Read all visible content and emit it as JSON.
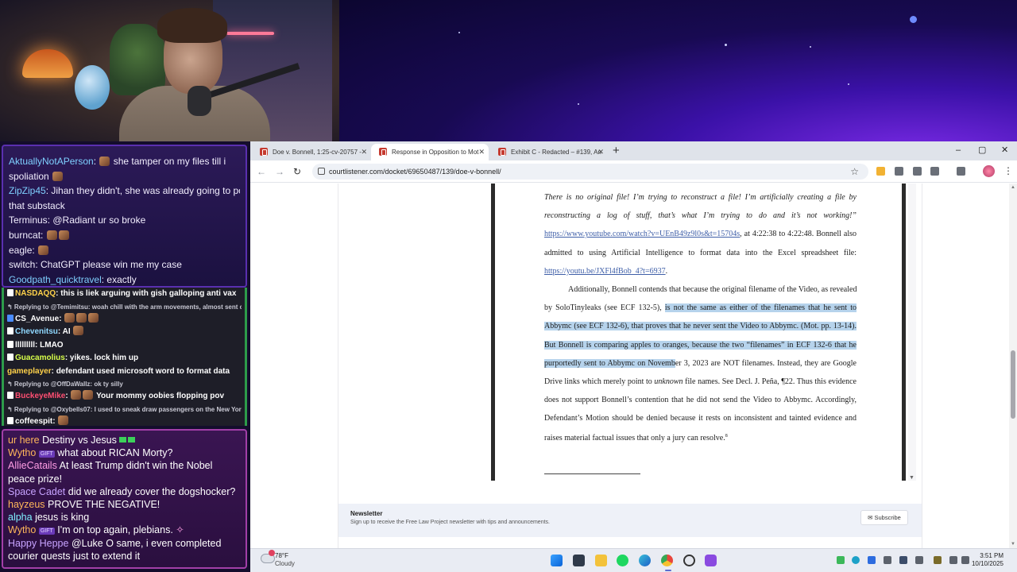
{
  "chat_top": [
    {
      "user": "AktuallyNotAPerson",
      "text": "she tamper on my files till i",
      "style": "blue"
    },
    {
      "user": "",
      "text": "spoliation",
      "style": "plain"
    },
    {
      "user": "ZipZip45",
      "text": "Jihan they didn't, she was already going to post",
      "style": "blue"
    },
    {
      "user": "",
      "text": "that substack",
      "style": "plain"
    },
    {
      "user": "Terminus",
      "text": "@Radiant ur so broke",
      "style": "plain"
    },
    {
      "user": "burncat",
      "text": "",
      "style": "plain"
    },
    {
      "user": "eagle",
      "text": "",
      "style": "plain"
    },
    {
      "user": "switch",
      "text": "ChatGPT please win me my case",
      "style": "plain"
    },
    {
      "user": "Goodpath_quicktravel",
      "text": "exactly",
      "style": "blue"
    }
  ],
  "chat_mid": [
    {
      "name": "NASDAQQ",
      "text": "this is liek arguing with gish galloping anti vax",
      "type": "msg",
      "color": "gold"
    },
    {
      "name": "",
      "text": "↰ Replying to @Temimitsu: woah chill with the arm movements, almost sent c",
      "type": "reply",
      "color": ""
    },
    {
      "name": "CS_Avenue",
      "text": "",
      "type": "msg",
      "color": "white"
    },
    {
      "name": "Chevenitsu",
      "text": "AI",
      "type": "msg",
      "color": "blue"
    },
    {
      "name": "lllllllll",
      "text": "LMAO",
      "type": "msg",
      "color": "white"
    },
    {
      "name": "Guacamolius",
      "text": "yikes. lock him up",
      "type": "msg",
      "color": "lime"
    },
    {
      "name": "gameplayer",
      "text": "defendant used microsoft word to format data",
      "type": "msg",
      "color": "gold"
    },
    {
      "name": "",
      "text": "↰ Replying to @OffDaWallz: ok ty silly",
      "type": "reply",
      "color": ""
    },
    {
      "name": "BuckeyeMike",
      "text": "Your mommy oobies flopping pov",
      "type": "msg",
      "color": "pink"
    },
    {
      "name": "",
      "text": "↰ Replying to @Oxybells07: I used to sneak draw passengers on the New York",
      "type": "reply",
      "color": ""
    },
    {
      "name": "coffeespit",
      "text": "",
      "type": "msg",
      "color": "white"
    }
  ],
  "chat_bottom": [
    {
      "user": "ur here",
      "text": "Destiny vs Jesus",
      "color": "orange",
      "tag": false
    },
    {
      "user": "Wytho",
      "text": "what about RICAN Morty?",
      "color": "orange",
      "tag": true
    },
    {
      "user": "AllieCatails",
      "text": "At least Trump didn't win the Nobel peace prize!",
      "color": "pink",
      "tag": false
    },
    {
      "user": "Space Cadet",
      "text": "did we already cover the dogshocker?",
      "color": "violet",
      "tag": false
    },
    {
      "user": "hayzeus",
      "text": "PROVE THE NEGATIVE!",
      "color": "orange",
      "tag": false
    },
    {
      "user": "alpha",
      "text": "jesus is king",
      "color": "cyan",
      "tag": false
    },
    {
      "user": "Wytho",
      "text": "I'm on top again, plebians.",
      "color": "orange",
      "tag": true
    },
    {
      "user": "Happy Heppe",
      "text": "@Luke O same, i even completed courier quests just to extend it",
      "color": "violet",
      "tag": false
    }
  ],
  "chat_tag": "GIFT",
  "browser": {
    "tabs": [
      {
        "title": "Doe v. Bonnell, 1:25-cv-20757 -",
        "active": false
      },
      {
        "title": "Response in Opposition to Mot",
        "active": true
      },
      {
        "title": "Exhibit C - Redacted – #139, An",
        "active": false
      }
    ],
    "new_tab": "+",
    "url": "courtlistener.com/docket/69650487/139/doe-v-bonnell/",
    "window": {
      "minimize": "–",
      "maximize": "▢",
      "close": "✕"
    }
  },
  "pdf": {
    "line1": "There is no original file! I’m trying to reconstruct a file! I’m artificially creating a file by",
    "line2": "reconstructing a log of stuff, that’s what I’m trying to do and it’s not working!”",
    "line3_link": "https://www.youtube.com/watch?v=UEnB49z9l0s&t=15704s",
    "line3_rest": ", at 4:22:38 to 4:22:48.  Bonnell also",
    "line4": "admitted to using Artificial Intelligence to format data into the Excel spreadsheet file:",
    "line5_link": "https://youtu.be/JXFl4fBob_4?t=6937",
    "line5_rest": ".",
    "line6": "Additionally, Bonnell contends that because the original filename of the Video, as revealed",
    "line7_a": "by SoloTinyleaks (see ECF 132-5), ",
    "line7_hl": "is not the same as either of the filenames that he sent to",
    "line8_hl": "Abbymc (see ECF 132-6), that proves that he never sent the Video to Abbymc. (Mot. pp. 13-14).",
    "line9_hl": "But Bonnell is comparing apples to oranges, because the two “filenames” in ECF 132-6 that he",
    "line10_hl": "purportedly sent to Abbymc on Novemb",
    "line10_rest": "er 3, 2023 are NOT filenames. Instead, they are Google",
    "line11_a": "Drive links which merely point to ",
    "line11_em": "unknown",
    "line11_b": " file names. See Decl. J. Peña, ¶22. Thus this evidence",
    "line12": "does not support Bonnell’s contention that he did not send the Video to Abbymc. Accordingly,",
    "line13": "Defendant’s Motion should be denied because it rests on inconsistent and tainted evidence and",
    "line14": "raises material factual issues that only a jury can resolve.",
    "footnote_mark": "8"
  },
  "newsletter": {
    "title": "Newsletter",
    "text": "Sign up to receive the Free Law Project newsletter with tips and announcements.",
    "button": "Subscribe"
  },
  "taskbar": {
    "temp": "78°F",
    "condition": "Cloudy",
    "time": "3:51 PM",
    "date": "10/10/2025"
  }
}
